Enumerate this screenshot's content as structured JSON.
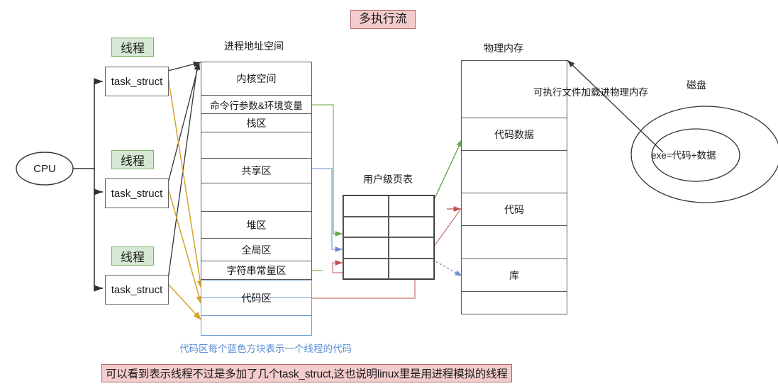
{
  "title_banner": "多执行流",
  "bottom_banner": "可以看到表示线程不过是多加了几个task_struct,这也说明linux里是用进程模拟的线程",
  "blue_caption": "代码区每个蓝色方块表示一个线程的代码",
  "cpu": {
    "label": "CPU"
  },
  "threads": [
    {
      "tag": "线程",
      "task": "task_struct"
    },
    {
      "tag": "线程",
      "task": "task_struct"
    },
    {
      "tag": "线程",
      "task": "task_struct"
    }
  ],
  "address_space": {
    "title": "进程地址空间",
    "rows": [
      "内核空间",
      "命令行参数&环境变量",
      "栈区",
      "",
      "共享区",
      "",
      "堆区",
      "全局区",
      "字符串常量区"
    ],
    "code_label": "代码区",
    "code_blocks": [
      "",
      "",
      ""
    ]
  },
  "page_table": {
    "title": "用户级页表",
    "rows": 4,
    "cols": 2
  },
  "physical_memory": {
    "title": "物理内存",
    "rows": [
      "",
      "代码数据",
      "",
      "代码",
      "",
      "库",
      ""
    ]
  },
  "disk": {
    "title": "磁盘",
    "exe": "exe=代码+数据"
  },
  "load_label": "可执行文件加载进物理内存",
  "colors": {
    "banner_bg": "#f4cccc",
    "banner_border": "#b06a6a",
    "thread_bg": "#d5e8d4",
    "thread_border": "#82b366",
    "blue_caption": "#5b8ed6",
    "code_border": "#6c9bd2",
    "arrow_black": "#333333",
    "arrow_orange": "#d6a328",
    "arrow_green": "#6aa84f",
    "arrow_blue": "#6d8fd0",
    "arrow_red": "#b85450",
    "box_border": "#595959"
  }
}
